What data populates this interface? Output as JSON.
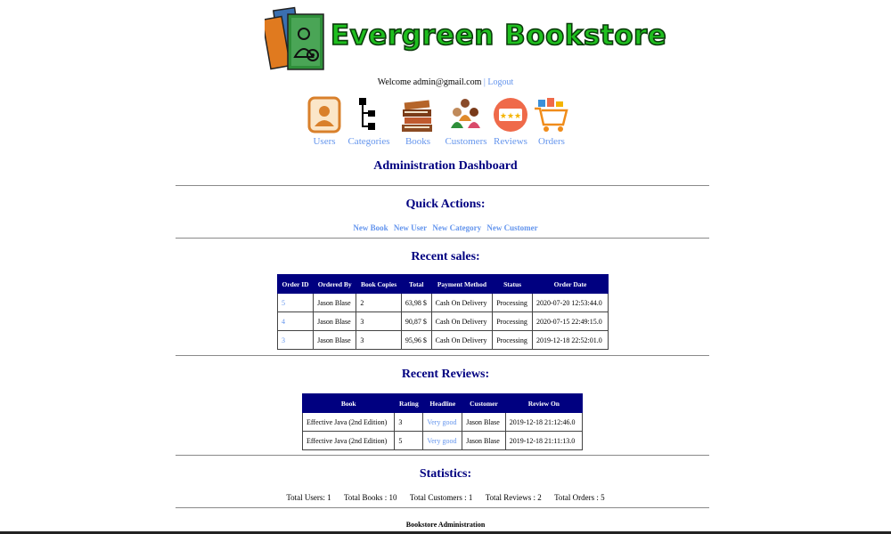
{
  "brand": {
    "name": "Evergreen Bookstore"
  },
  "header": {
    "welcome_text": "Welcome admin@gmail.com",
    "separator": "|",
    "logout_label": "Logout"
  },
  "nav": {
    "items": [
      {
        "label": "Users",
        "icon": "user-icon"
      },
      {
        "label": "Categories",
        "icon": "hierarchy-icon"
      },
      {
        "label": "Books",
        "icon": "books-icon"
      },
      {
        "label": "Customers",
        "icon": "customers-icon"
      },
      {
        "label": "Reviews",
        "icon": "review-stars-icon"
      },
      {
        "label": "Orders",
        "icon": "shopping-cart-icon"
      }
    ]
  },
  "dashboard": {
    "title": "Administration Dashboard"
  },
  "quick_actions": {
    "title": "Quick Actions:",
    "links": [
      "New Book",
      "New User",
      "New Category",
      "New Customer"
    ]
  },
  "recent_sales": {
    "title": "Recent sales:",
    "columns": [
      "Order ID",
      "Ordered By",
      "Book Copies",
      "Total",
      "Payment Method",
      "Status",
      "Order Date"
    ],
    "rows": [
      [
        "5",
        "Jason Blase",
        "2",
        "63,98 $",
        "Cash On Delivery",
        "Processing",
        "2020-07-20 12:53:44.0"
      ],
      [
        "4",
        "Jason Blase",
        "3",
        "90,87 $",
        "Cash On Delivery",
        "Processing",
        "2020-07-15 22:49:15.0"
      ],
      [
        "3",
        "Jason Blase",
        "3",
        "95,96 $",
        "Cash On Delivery",
        "Processing",
        "2019-12-18 22:52:01.0"
      ]
    ]
  },
  "recent_reviews": {
    "title": "Recent Reviews:",
    "columns": [
      "Book",
      "Rating",
      "Headline",
      "Customer",
      "Review On"
    ],
    "rows": [
      [
        "Effective Java (2nd Edition)",
        "3",
        "Very good",
        "Jason Blase",
        "2019-12-18 21:12:46.0"
      ],
      [
        "Effective Java (2nd Edition)",
        "5",
        "Very good",
        "Jason Blase",
        "2019-12-18 21:11:13.0"
      ]
    ]
  },
  "statistics": {
    "title": "Statistics:",
    "items": [
      "Total Users: 1",
      "Total Books : 10",
      "Total Customers : 1",
      "Total Reviews : 2",
      "Total Orders : 5"
    ]
  },
  "footer": {
    "text": "Bookstore Administration"
  },
  "colors": {
    "heading": "#000080",
    "link": "#6495ed",
    "table_header_bg": "#000080",
    "brand_green": "#1fbf1f"
  }
}
